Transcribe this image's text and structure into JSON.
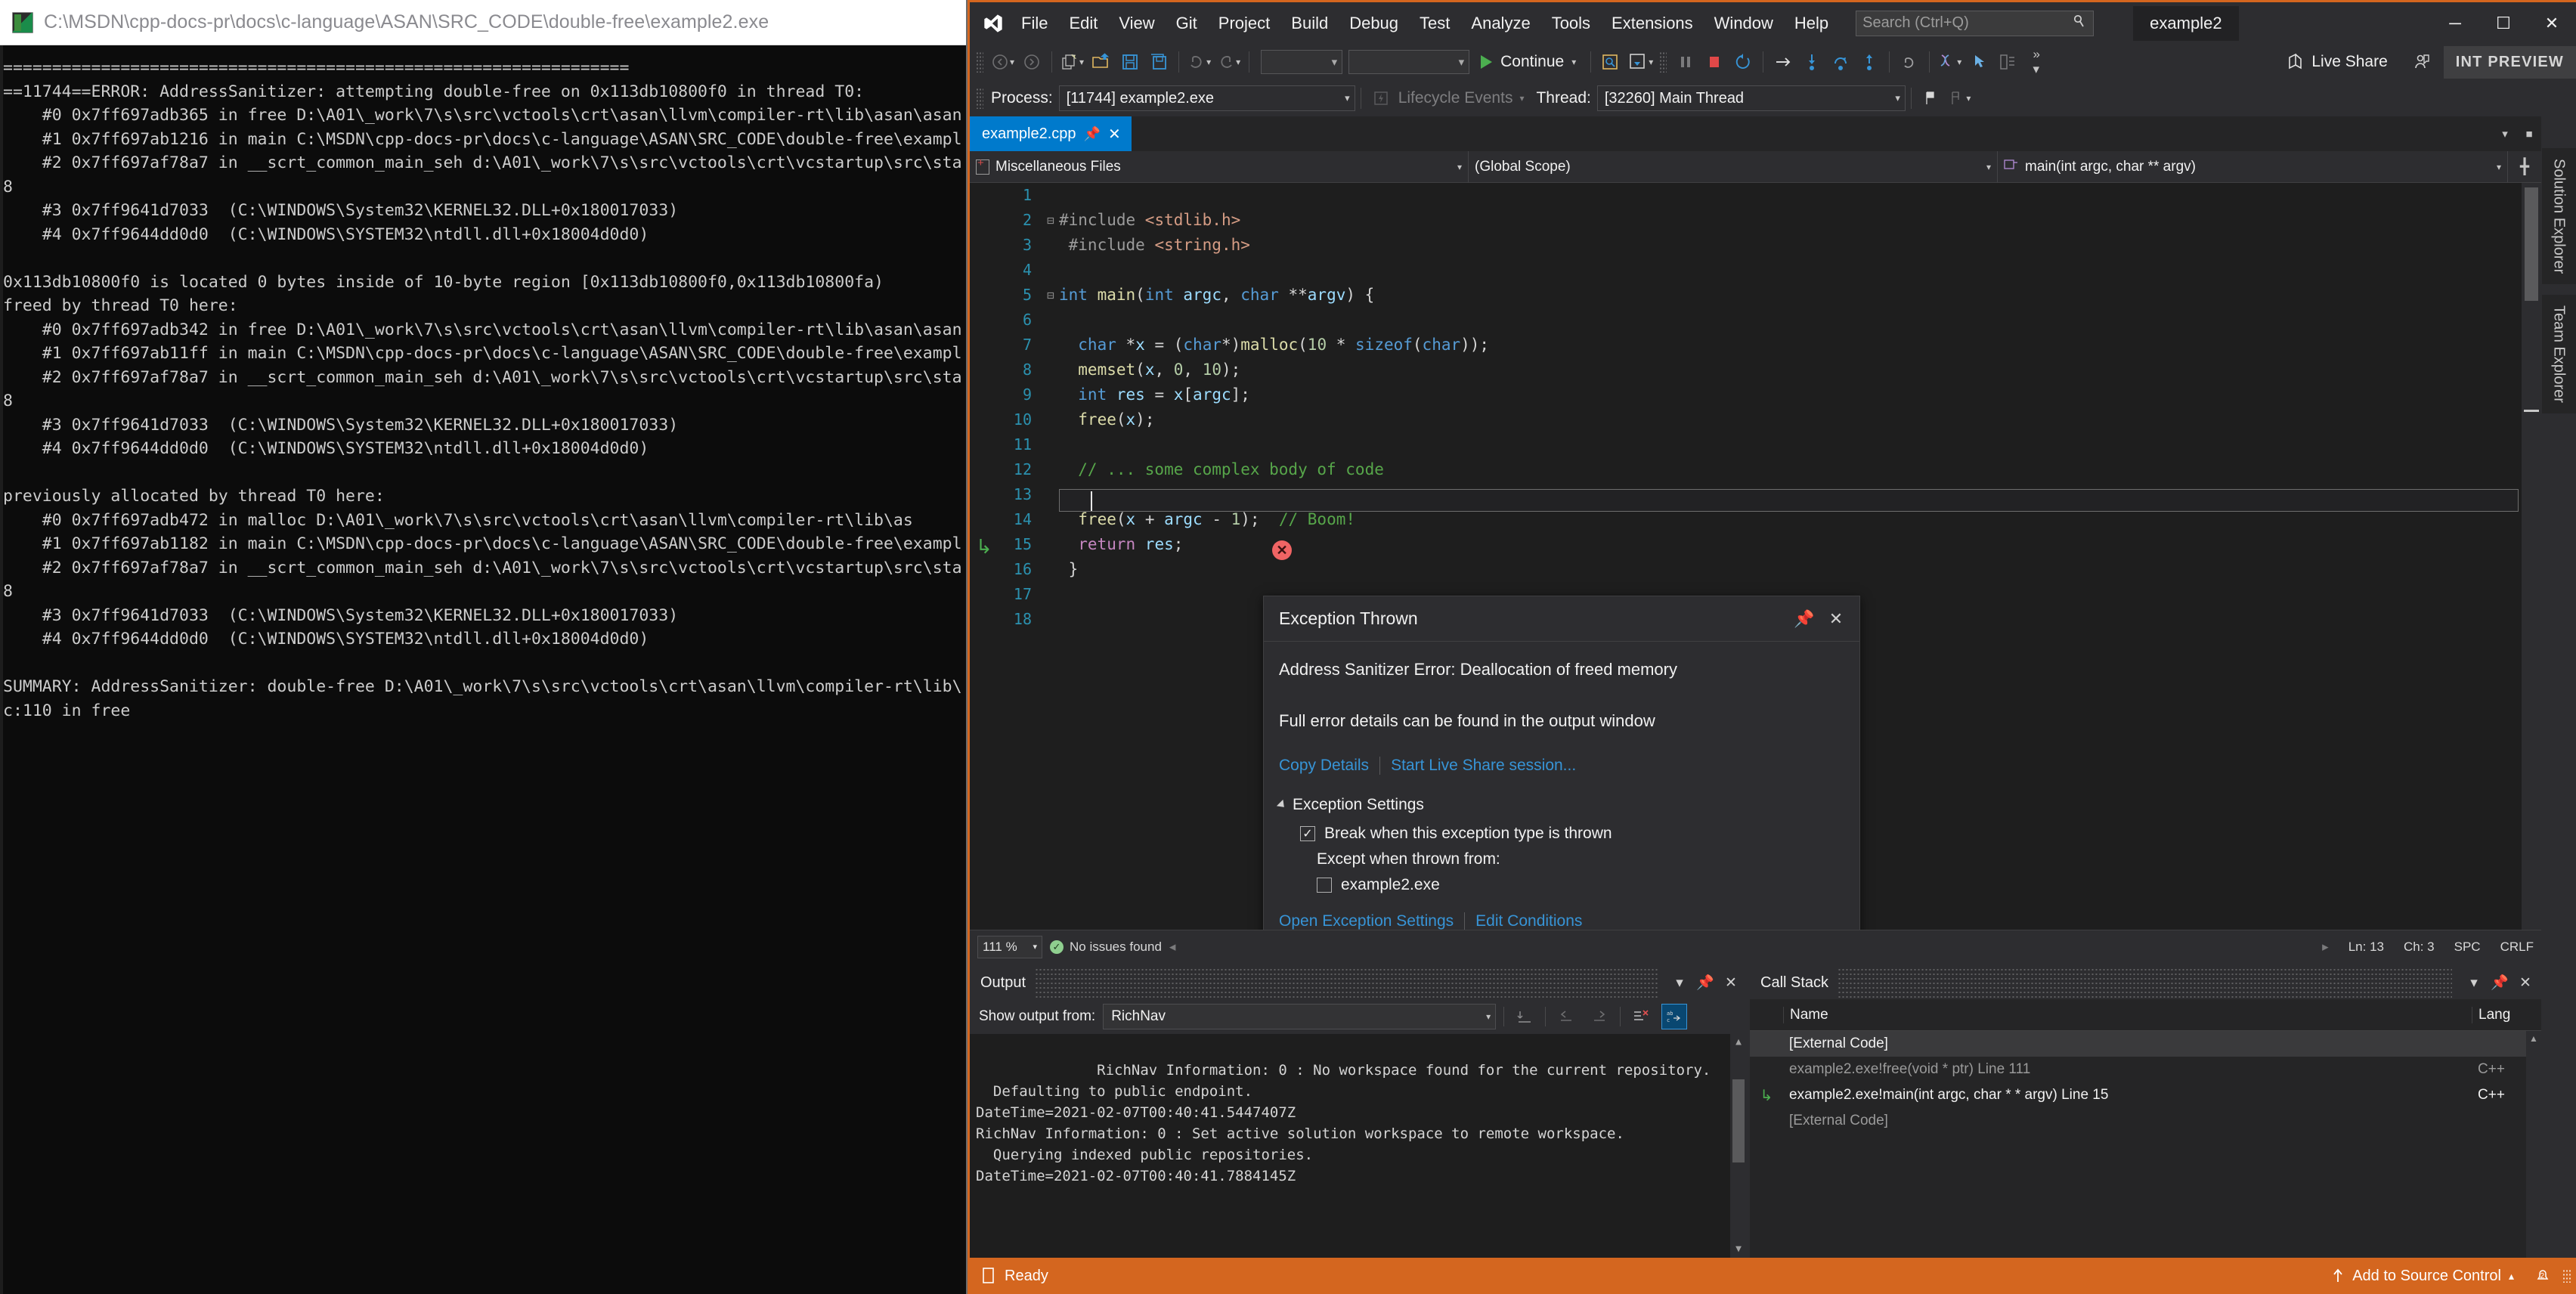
{
  "console": {
    "title": "C:\\MSDN\\cpp-docs-pr\\docs\\c-language\\ASAN\\SRC_CODE\\double-free\\example2.exe",
    "icon": "console-icon",
    "output": "================================================================\n==11744==ERROR: AddressSanitizer: attempting double-free on 0x113db10800f0 in thread T0:\n    #0 0x7ff697adb365 in free D:\\A01\\_work\\7\\s\\src\\vctools\\crt\\asan\\llvm\\compiler-rt\\lib\\asan\\asan\n    #1 0x7ff697ab1216 in main C:\\MSDN\\cpp-docs-pr\\docs\\c-language\\ASAN\\SRC_CODE\\double-free\\exampl\n    #2 0x7ff697af78a7 in __scrt_common_main_seh d:\\A01\\_work\\7\\s\\src\\vctools\\crt\\vcstartup\\src\\sta\n8\n    #3 0x7ff9641d7033  (C:\\WINDOWS\\System32\\KERNEL32.DLL+0x180017033)\n    #4 0x7ff9644dd0d0  (C:\\WINDOWS\\SYSTEM32\\ntdll.dll+0x18004d0d0)\n\n0x113db10800f0 is located 0 bytes inside of 10-byte region [0x113db10800f0,0x113db10800fa)\nfreed by thread T0 here:\n    #0 0x7ff697adb342 in free D:\\A01\\_work\\7\\s\\src\\vctools\\crt\\asan\\llvm\\compiler-rt\\lib\\asan\\asan\n    #1 0x7ff697ab11ff in main C:\\MSDN\\cpp-docs-pr\\docs\\c-language\\ASAN\\SRC_CODE\\double-free\\exampl\n    #2 0x7ff697af78a7 in __scrt_common_main_seh d:\\A01\\_work\\7\\s\\src\\vctools\\crt\\vcstartup\\src\\sta\n8\n    #3 0x7ff9641d7033  (C:\\WINDOWS\\System32\\KERNEL32.DLL+0x180017033)\n    #4 0x7ff9644dd0d0  (C:\\WINDOWS\\SYSTEM32\\ntdll.dll+0x18004d0d0)\n\npreviously allocated by thread T0 here:\n    #0 0x7ff697adb472 in malloc D:\\A01\\_work\\7\\s\\src\\vctools\\crt\\asan\\llvm\\compiler-rt\\lib\\as\n    #1 0x7ff697ab1182 in main C:\\MSDN\\cpp-docs-pr\\docs\\c-language\\ASAN\\SRC_CODE\\double-free\\exampl\n    #2 0x7ff697af78a7 in __scrt_common_main_seh d:\\A01\\_work\\7\\s\\src\\vctools\\crt\\vcstartup\\src\\sta\n8\n    #3 0x7ff9641d7033  (C:\\WINDOWS\\System32\\KERNEL32.DLL+0x180017033)\n    #4 0x7ff9644dd0d0  (C:\\WINDOWS\\SYSTEM32\\ntdll.dll+0x18004d0d0)\n\nSUMMARY: AddressSanitizer: double-free D:\\A01\\_work\\7\\s\\src\\vctools\\crt\\asan\\llvm\\compiler-rt\\lib\\\nc:110 in free"
  },
  "titlebar": {
    "logo": "visual-studio-logo",
    "menu": [
      "File",
      "Edit",
      "View",
      "Git",
      "Project",
      "Build",
      "Debug",
      "Test",
      "Analyze",
      "Tools",
      "Extensions",
      "Window",
      "Help"
    ],
    "search_placeholder": "Search (Ctrl+Q)",
    "window_title": "example2",
    "minimize": "─",
    "maximize": "☐",
    "close": "✕"
  },
  "toolbar": {
    "back_label": "navigate-backward",
    "forward_label": "navigate-forward",
    "continue_label": "Continue",
    "live_share_label": "Live Share",
    "preview_badge": "INT PREVIEW",
    "config_combo": "",
    "platform_combo": ""
  },
  "debugbar": {
    "process_label": "Process:",
    "process_value": "[11744] example2.exe",
    "lifecycle_label": "Lifecycle Events",
    "thread_label": "Thread:",
    "thread_value": "[32260] Main Thread"
  },
  "tabs": {
    "active": "example2.cpp",
    "pin_icon": "pin-icon",
    "close_icon": "close-icon"
  },
  "navbar": {
    "project": "Miscellaneous Files",
    "scope": "(Global Scope)",
    "function": "main(int argc, char ** argv)"
  },
  "editor": {
    "lines": [
      {
        "n": "1",
        "fold": "",
        "segs": []
      },
      {
        "n": "2",
        "fold": "-",
        "segs": [
          [
            "pp",
            "#include "
          ],
          [
            "str",
            "<stdlib.h>"
          ]
        ]
      },
      {
        "n": "3",
        "fold": "",
        "segs": [
          [
            "pp",
            " #include "
          ],
          [
            "str",
            "<string.h>"
          ]
        ]
      },
      {
        "n": "4",
        "fold": "",
        "segs": []
      },
      {
        "n": "5",
        "fold": "-",
        "segs": [
          [
            "kw",
            "int "
          ],
          [
            "fn",
            "main"
          ],
          [
            "punct",
            "("
          ],
          [
            "kw",
            "int "
          ],
          [
            "id",
            "argc"
          ],
          [
            "punct",
            ", "
          ],
          [
            "kw",
            "char "
          ],
          [
            "punct",
            "**"
          ],
          [
            "id",
            "argv"
          ],
          [
            "punct",
            ") {"
          ]
        ]
      },
      {
        "n": "6",
        "fold": "",
        "segs": []
      },
      {
        "n": "7",
        "fold": "",
        "segs": [
          [
            "kw",
            "  char "
          ],
          [
            "punct",
            "*"
          ],
          [
            "id",
            "x"
          ],
          [
            "punct",
            " = ("
          ],
          [
            "kw",
            "char"
          ],
          [
            "punct",
            "*)"
          ],
          [
            "fn",
            "malloc"
          ],
          [
            "punct",
            "("
          ],
          [
            "num",
            "10"
          ],
          [
            "punct",
            " * "
          ],
          [
            "kw",
            "sizeof"
          ],
          [
            "punct",
            "("
          ],
          [
            "kw",
            "char"
          ],
          [
            "punct",
            "));"
          ]
        ]
      },
      {
        "n": "8",
        "fold": "",
        "segs": [
          [
            "fn",
            "  memset"
          ],
          [
            "punct",
            "("
          ],
          [
            "id",
            "x"
          ],
          [
            "punct",
            ", "
          ],
          [
            "num",
            "0"
          ],
          [
            "punct",
            ", "
          ],
          [
            "num",
            "10"
          ],
          [
            "punct",
            ");"
          ]
        ]
      },
      {
        "n": "9",
        "fold": "",
        "segs": [
          [
            "kw",
            "  int "
          ],
          [
            "id",
            "res"
          ],
          [
            "punct",
            " = "
          ],
          [
            "id",
            "x"
          ],
          [
            "punct",
            "["
          ],
          [
            "id",
            "argc"
          ],
          [
            "punct",
            "];"
          ]
        ]
      },
      {
        "n": "10",
        "fold": "",
        "segs": [
          [
            "fn",
            "  free"
          ],
          [
            "punct",
            "("
          ],
          [
            "id",
            "x"
          ],
          [
            "punct",
            ");"
          ]
        ]
      },
      {
        "n": "11",
        "fold": "",
        "segs": []
      },
      {
        "n": "12",
        "fold": "",
        "segs": [
          [
            "cmt",
            "  // ... some complex body of code"
          ]
        ]
      },
      {
        "n": "13",
        "fold": "",
        "segs": []
      },
      {
        "n": "14",
        "fold": "",
        "segs": [
          [
            "fn",
            "  free"
          ],
          [
            "punct",
            "("
          ],
          [
            "id",
            "x"
          ],
          [
            "punct",
            " + "
          ],
          [
            "id",
            "argc"
          ],
          [
            "punct",
            " - "
          ],
          [
            "num",
            "1"
          ],
          [
            "punct",
            ");  "
          ],
          [
            "cmt",
            "// Boom!"
          ]
        ]
      },
      {
        "n": "15",
        "fold": "",
        "segs": [
          [
            "kw2",
            "  return "
          ],
          [
            "id",
            "res"
          ],
          [
            "punct",
            ";"
          ]
        ]
      },
      {
        "n": "16",
        "fold": "",
        "segs": [
          [
            "punct",
            " }"
          ]
        ]
      },
      {
        "n": "17",
        "fold": "",
        "segs": []
      },
      {
        "n": "18",
        "fold": "",
        "segs": []
      }
    ],
    "error_marker": "✕",
    "current_statement_icon": "current-statement-arrow"
  },
  "exception_dialog": {
    "title": "Exception Thrown",
    "pin_icon": "pin-icon",
    "close_icon": "close-icon",
    "message": "Address Sanitizer Error: Deallocation of freed memory",
    "hint": "Full error details can be found in the output window",
    "copy_details": "Copy Details",
    "live_share": "Start Live Share session...",
    "settings_header": "Exception Settings",
    "break_checkbox_label": "Break when this exception type is thrown",
    "break_checked": "✓",
    "except_when_label": "Except when thrown from:",
    "exe_checkbox_label": "example2.exe",
    "open_settings": "Open Exception Settings",
    "edit_conditions": "Edit Conditions"
  },
  "editor_status": {
    "zoom": "111 %",
    "issues": "No issues found",
    "line": "Ln: 13",
    "col": "Ch: 3",
    "spaces": "SPC",
    "eol": "CRLF"
  },
  "output_panel": {
    "title": "Output",
    "show_from_label": "Show output from:",
    "source": "RichNav",
    "text": "RichNav Information: 0 : No workspace found for the current repository.\n  Defaulting to public endpoint.\nDateTime=2021-02-07T00:40:41.5447407Z\nRichNav Information: 0 : Set active solution workspace to remote workspace.\n  Querying indexed public repositories.\nDateTime=2021-02-07T00:40:41.7884145Z",
    "icons": [
      "clear-all-icon",
      "nav-prev-icon",
      "nav-next-icon",
      "clear-output-icon",
      "word-wrap-icon"
    ]
  },
  "callstack_panel": {
    "title": "Call Stack",
    "columns": [
      "Name",
      "Lang"
    ],
    "rows": [
      {
        "name": "[External Code]",
        "lang": "",
        "state": "sel"
      },
      {
        "name": "example2.exe!free(void * ptr) Line 111",
        "lang": "C++",
        "state": "dim"
      },
      {
        "name": "example2.exe!main(int argc, char * * argv) Line 15",
        "lang": "C++",
        "state": "cur"
      },
      {
        "name": "[External Code]",
        "lang": "",
        "state": "dim"
      }
    ]
  },
  "right_rail": {
    "tabs": [
      "Solution Explorer",
      "Team Explorer"
    ]
  },
  "status_bar": {
    "ready": "Ready",
    "add_to_source_control": "Add to Source Control",
    "notifications": "notifications-icon"
  },
  "colors": {
    "accent": "#007acc",
    "status_orange": "#d4661f",
    "link": "#3794d6",
    "error_red": "#f06464"
  }
}
